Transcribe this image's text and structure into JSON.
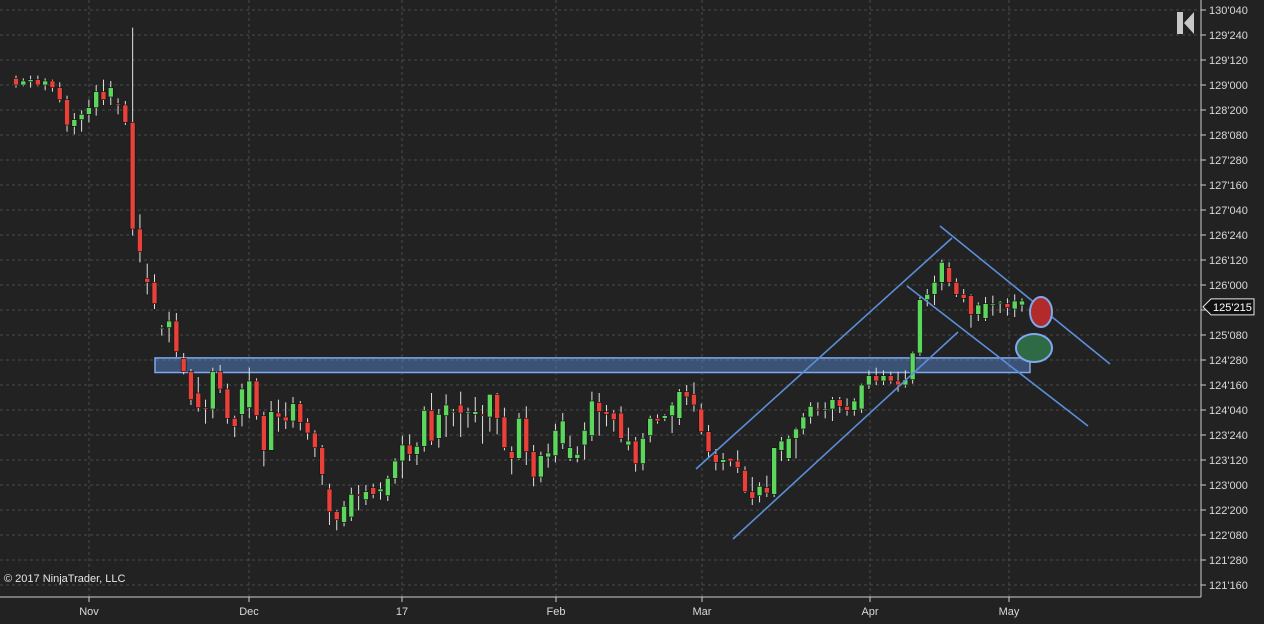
{
  "chart_data": {
    "type": "candlestick",
    "title": "",
    "price_format": "32nds of a point, e.g. 125'215 = 125 + 21.5/32",
    "ylim": [
      "121'160",
      "130'040"
    ],
    "y_ticks": [
      "130'040",
      "129'240",
      "129'120",
      "129'000",
      "128'200",
      "128'080",
      "127'280",
      "127'160",
      "127'040",
      "126'240",
      "126'120",
      "126'000",
      "125'200",
      "125'080",
      "124'280",
      "124'160",
      "124'040",
      "123'240",
      "123'120",
      "123'000",
      "122'200",
      "122'080",
      "121'280",
      "121'160"
    ],
    "x_ticks": [
      "Nov",
      "Dec",
      "17",
      "Feb",
      "Mar",
      "Apr",
      "May"
    ],
    "last_price_label": "125'215",
    "grid": true,
    "candle_colors": {
      "up": "#5cd65c",
      "down": "#e8413a"
    },
    "annotations": {
      "support_zone": {
        "low": "124'220",
        "high": "124'290",
        "color": "#5b8fd9"
      },
      "line_color": "#5b8fd9",
      "circles": [
        {
          "meaning": "red marker",
          "color": "#b22a2a"
        },
        {
          "meaning": "green marker",
          "color": "#2e6b45"
        }
      ]
    },
    "candles_ohlc": [
      [
        129.1,
        129.14,
        128.96,
        129.0
      ],
      [
        129.0,
        129.1,
        128.98,
        129.06
      ],
      [
        129.05,
        129.14,
        128.96,
        129.08
      ],
      [
        129.08,
        129.14,
        128.98,
        129.0
      ],
      [
        129.0,
        129.1,
        128.92,
        129.06
      ],
      [
        129.06,
        129.08,
        128.9,
        128.96
      ],
      [
        128.96,
        129.04,
        128.74,
        128.78
      ],
      [
        128.78,
        128.84,
        128.3,
        128.4
      ],
      [
        128.38,
        128.58,
        128.26,
        128.48
      ],
      [
        128.48,
        128.62,
        128.3,
        128.56
      ],
      [
        128.56,
        128.78,
        128.44,
        128.66
      ],
      [
        128.66,
        129.0,
        128.54,
        128.9
      ],
      [
        128.9,
        129.08,
        128.7,
        128.78
      ],
      [
        128.82,
        129.06,
        128.7,
        128.96
      ],
      [
        128.72,
        128.8,
        128.56,
        128.7
      ],
      [
        128.7,
        128.76,
        128.4,
        128.44
      ],
      [
        128.44,
        129.86,
        126.74,
        126.84
      ],
      [
        126.84,
        127.06,
        126.34,
        126.5
      ],
      [
        126.1,
        126.32,
        125.86,
        126.04
      ],
      [
        126.04,
        126.16,
        125.64,
        125.72
      ],
      [
        125.36,
        125.4,
        125.24,
        125.36
      ],
      [
        125.36,
        125.6,
        125.14,
        125.46
      ],
      [
        125.46,
        125.58,
        124.92,
        125.0
      ],
      [
        124.9,
        124.98,
        124.66,
        124.7
      ],
      [
        124.7,
        124.74,
        124.2,
        124.28
      ],
      [
        124.38,
        124.62,
        124.1,
        124.16
      ],
      [
        124.16,
        124.28,
        123.92,
        124.14
      ],
      [
        124.14,
        124.76,
        124.0,
        124.7
      ],
      [
        124.7,
        124.8,
        124.38,
        124.44
      ],
      [
        124.44,
        124.52,
        123.92,
        124.0
      ],
      [
        124.0,
        124.04,
        123.72,
        123.88
      ],
      [
        124.06,
        124.52,
        123.88,
        124.44
      ],
      [
        124.16,
        124.76,
        124.0,
        124.56
      ],
      [
        124.56,
        124.6,
        123.98,
        124.04
      ],
      [
        124.04,
        124.1,
        123.28,
        123.52
      ],
      [
        123.52,
        124.26,
        123.52,
        124.1
      ],
      [
        124.08,
        124.28,
        123.8,
        124.02
      ],
      [
        124.02,
        124.24,
        123.84,
        123.96
      ],
      [
        123.96,
        124.32,
        123.86,
        124.22
      ],
      [
        124.22,
        124.26,
        123.82,
        123.94
      ],
      [
        123.94,
        124.0,
        123.68,
        123.78
      ],
      [
        123.78,
        123.82,
        123.42,
        123.56
      ],
      [
        123.56,
        123.6,
        123.0,
        123.16
      ],
      [
        122.94,
        123.02,
        122.4,
        122.6
      ],
      [
        122.6,
        122.62,
        122.32,
        122.48
      ],
      [
        122.44,
        122.76,
        122.38,
        122.68
      ],
      [
        122.52,
        122.96,
        122.46,
        122.86
      ],
      [
        122.86,
        123.0,
        122.62,
        122.84
      ],
      [
        122.78,
        123.0,
        122.7,
        122.9
      ],
      [
        122.96,
        123.02,
        122.8,
        122.86
      ],
      [
        122.9,
        123.04,
        122.78,
        122.94
      ],
      [
        122.84,
        123.14,
        122.76,
        123.1
      ],
      [
        123.1,
        123.4,
        123.02,
        123.36
      ],
      [
        123.36,
        123.74,
        123.1,
        123.6
      ],
      [
        123.6,
        123.76,
        123.36,
        123.46
      ],
      [
        123.46,
        123.64,
        123.3,
        123.58
      ],
      [
        123.58,
        124.18,
        123.5,
        124.12
      ],
      [
        124.12,
        124.38,
        123.6,
        123.66
      ],
      [
        123.7,
        124.14,
        123.56,
        124.06
      ],
      [
        124.04,
        124.36,
        123.72,
        124.2
      ],
      [
        124.1,
        124.14,
        123.88,
        124.1
      ],
      [
        124.2,
        124.4,
        123.72,
        124.08
      ],
      [
        124.08,
        124.16,
        123.86,
        124.1
      ],
      [
        124.06,
        124.32,
        123.94,
        124.1
      ],
      [
        124.06,
        124.2,
        123.62,
        124.04
      ],
      [
        124.02,
        124.36,
        123.8,
        124.36
      ],
      [
        124.36,
        124.38,
        123.76,
        124.0
      ],
      [
        124.02,
        124.16,
        123.52,
        123.56
      ],
      [
        123.5,
        123.58,
        123.16,
        123.4
      ],
      [
        123.4,
        124.08,
        123.38,
        124.0
      ],
      [
        124.0,
        124.18,
        123.3,
        123.5
      ],
      [
        123.5,
        123.6,
        122.98,
        123.12
      ],
      [
        123.12,
        123.5,
        123.04,
        123.44
      ],
      [
        123.42,
        123.62,
        123.26,
        123.48
      ],
      [
        123.44,
        123.92,
        123.34,
        123.82
      ],
      [
        123.62,
        124.08,
        123.54,
        123.96
      ],
      [
        123.4,
        123.74,
        123.36,
        123.56
      ],
      [
        123.4,
        123.58,
        123.34,
        123.46
      ],
      [
        123.6,
        123.94,
        123.38,
        123.82
      ],
      [
        123.74,
        124.4,
        123.66,
        124.26
      ],
      [
        124.24,
        124.38,
        123.74,
        124.1
      ],
      [
        124.1,
        124.2,
        123.88,
        124.06
      ],
      [
        124.08,
        124.12,
        123.8,
        123.98
      ],
      [
        124.08,
        124.18,
        123.64,
        123.7
      ],
      [
        123.6,
        123.86,
        123.52,
        123.66
      ],
      [
        123.66,
        123.72,
        123.2,
        123.32
      ],
      [
        123.32,
        123.78,
        123.22,
        123.7
      ],
      [
        123.74,
        124.04,
        123.64,
        124.0
      ],
      [
        124.0,
        124.06,
        123.92,
        123.96
      ],
      [
        124.0,
        124.06,
        123.96,
        124.04
      ],
      [
        124.04,
        124.24,
        123.78,
        124.2
      ],
      [
        124.0,
        124.44,
        123.9,
        124.4
      ],
      [
        124.4,
        124.5,
        124.2,
        124.32
      ],
      [
        124.36,
        124.54,
        124.1,
        124.2
      ],
      [
        124.14,
        124.22,
        123.76,
        123.8
      ],
      [
        123.8,
        123.9,
        123.42,
        123.5
      ],
      [
        123.46,
        123.54,
        123.22,
        123.34
      ],
      [
        123.34,
        123.48,
        123.22,
        123.38
      ],
      [
        123.4,
        123.4,
        123.28,
        123.36
      ],
      [
        123.36,
        123.52,
        123.18,
        123.26
      ],
      [
        123.22,
        123.28,
        122.88,
        122.9
      ],
      [
        122.9,
        123.12,
        122.7,
        122.8
      ],
      [
        122.84,
        123.04,
        122.74,
        122.98
      ],
      [
        122.96,
        123.14,
        122.82,
        122.88
      ],
      [
        122.86,
        123.56,
        122.82,
        123.56
      ],
      [
        123.52,
        123.72,
        123.36,
        123.66
      ],
      [
        123.4,
        123.74,
        123.36,
        123.7
      ],
      [
        123.7,
        123.86,
        123.4,
        123.84
      ],
      [
        123.84,
        124.08,
        123.76,
        124.02
      ],
      [
        124.02,
        124.24,
        123.92,
        124.18
      ],
      [
        124.14,
        124.24,
        124.04,
        124.12
      ],
      [
        124.12,
        124.24,
        124.0,
        124.14
      ],
      [
        124.14,
        124.32,
        123.96,
        124.28
      ],
      [
        124.28,
        124.32,
        124.08,
        124.18
      ],
      [
        124.18,
        124.3,
        124.04,
        124.12
      ],
      [
        124.12,
        124.3,
        124.04,
        124.26
      ],
      [
        124.14,
        124.52,
        124.08,
        124.5
      ],
      [
        124.5,
        124.72,
        124.44,
        124.64
      ],
      [
        124.64,
        124.76,
        124.5,
        124.56
      ],
      [
        124.56,
        124.72,
        124.5,
        124.64
      ],
      [
        124.64,
        124.7,
        124.52,
        124.56
      ],
      [
        124.56,
        124.7,
        124.4,
        124.5
      ],
      [
        124.5,
        124.72,
        124.46,
        124.58
      ],
      [
        124.58,
        125.0,
        124.52,
        124.98
      ],
      [
        124.98,
        125.82,
        124.94,
        125.78
      ],
      [
        125.78,
        125.94,
        125.68,
        125.86
      ],
      [
        125.86,
        126.14,
        125.7,
        126.04
      ],
      [
        126.04,
        126.38,
        125.92,
        126.34
      ],
      [
        126.26,
        126.34,
        125.98,
        126.04
      ],
      [
        126.04,
        126.1,
        125.82,
        125.86
      ],
      [
        125.86,
        125.94,
        125.74,
        125.8
      ],
      [
        125.84,
        125.86,
        125.36,
        125.56
      ],
      [
        125.56,
        125.74,
        125.46,
        125.7
      ],
      [
        125.5,
        125.82,
        125.46,
        125.72
      ],
      [
        125.7,
        125.84,
        125.54,
        125.72
      ],
      [
        125.72,
        125.76,
        125.58,
        125.74
      ],
      [
        125.72,
        125.8,
        125.54,
        125.66
      ],
      [
        125.64,
        125.86,
        125.52,
        125.76
      ],
      [
        125.7,
        125.8,
        125.6,
        125.76
      ]
    ]
  }
}
